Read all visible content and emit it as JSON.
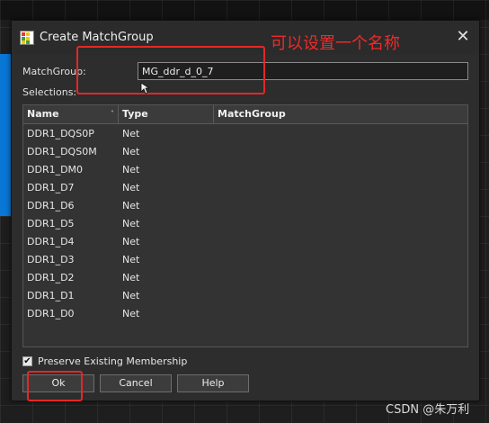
{
  "window": {
    "title": "Create MatchGroup",
    "close_symbol": "✕"
  },
  "annotation": {
    "note": "可以设置一个名称"
  },
  "form": {
    "matchgroup_label": "MatchGroup:",
    "matchgroup_value": "MG_ddr_d_0_7",
    "selections_label": "Selections:"
  },
  "table": {
    "columns": [
      "Name",
      "Type",
      "MatchGroup"
    ],
    "rows": [
      {
        "name": "DDR1_DQS0P",
        "type": "Net",
        "matchgroup": ""
      },
      {
        "name": "DDR1_DQS0M",
        "type": "Net",
        "matchgroup": ""
      },
      {
        "name": "DDR1_DM0",
        "type": "Net",
        "matchgroup": ""
      },
      {
        "name": "DDR1_D7",
        "type": "Net",
        "matchgroup": ""
      },
      {
        "name": "DDR1_D6",
        "type": "Net",
        "matchgroup": ""
      },
      {
        "name": "DDR1_D5",
        "type": "Net",
        "matchgroup": ""
      },
      {
        "name": "DDR1_D4",
        "type": "Net",
        "matchgroup": ""
      },
      {
        "name": "DDR1_D3",
        "type": "Net",
        "matchgroup": ""
      },
      {
        "name": "DDR1_D2",
        "type": "Net",
        "matchgroup": ""
      },
      {
        "name": "DDR1_D1",
        "type": "Net",
        "matchgroup": ""
      },
      {
        "name": "DDR1_D0",
        "type": "Net",
        "matchgroup": ""
      }
    ]
  },
  "options": {
    "preserve_label": "Preserve Existing Membership",
    "preserve_checked": true
  },
  "buttons": {
    "ok": "Ok",
    "cancel": "Cancel",
    "help": "Help"
  },
  "watermark": "CSDN @朱万利",
  "colors": {
    "annotation_red": "#e52727",
    "dialog_bg": "#2d2d2d",
    "accent_blue": "#0a77d6"
  }
}
